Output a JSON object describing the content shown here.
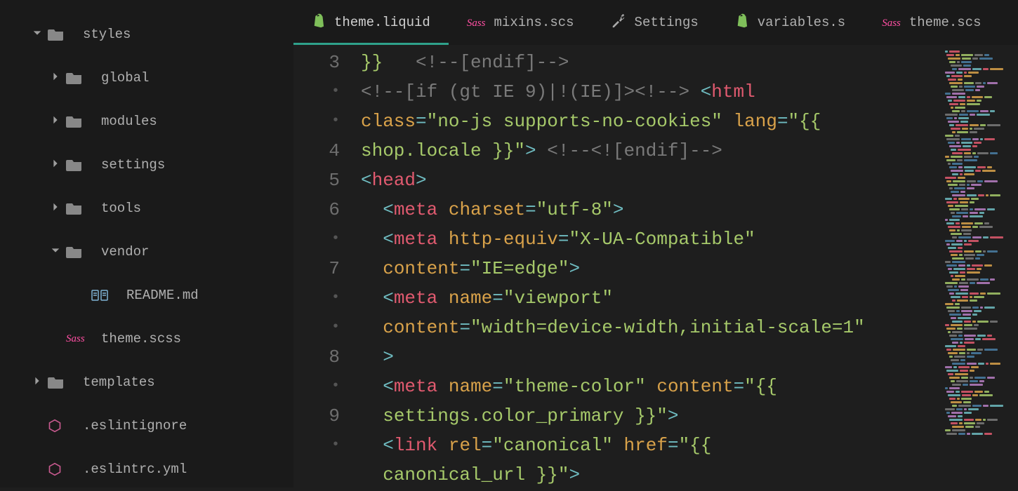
{
  "sidebar": {
    "items": [
      {
        "chevron": "down",
        "icon": "folder",
        "label": "styles",
        "indent": 0
      },
      {
        "chevron": "right",
        "icon": "folder",
        "label": "global",
        "indent": 1
      },
      {
        "chevron": "right",
        "icon": "folder",
        "label": "modules",
        "indent": 1
      },
      {
        "chevron": "right",
        "icon": "folder",
        "label": "settings",
        "indent": 1
      },
      {
        "chevron": "right",
        "icon": "folder",
        "label": "tools",
        "indent": 1
      },
      {
        "chevron": "down",
        "icon": "folder",
        "label": "vendor",
        "indent": 1
      },
      {
        "chevron": "",
        "icon": "markdown",
        "label": "README.md",
        "indent": 2
      },
      {
        "chevron": "",
        "icon": "sass",
        "label": "theme.scss",
        "indent": 1
      },
      {
        "chevron": "right",
        "icon": "folder",
        "label": "templates",
        "indent": 0
      },
      {
        "chevron": "",
        "icon": "hex",
        "label": ".eslintignore",
        "indent": 0
      },
      {
        "chevron": "",
        "icon": "hex",
        "label": ".eslintrc.yml",
        "indent": 0
      }
    ]
  },
  "tabs": [
    {
      "icon": "shopify",
      "label": "theme.liquid",
      "active": true
    },
    {
      "icon": "sass",
      "label": "mixins.scs"
    },
    {
      "icon": "tools",
      "label": "Settings"
    },
    {
      "icon": "shopify",
      "label": "variables.s"
    },
    {
      "icon": "sass",
      "label": "theme.scs"
    }
  ],
  "gutter": [
    "",
    "3",
    "·",
    "·",
    "4",
    "5",
    "6",
    "·",
    "7",
    "·",
    "·",
    "8",
    "·",
    "9",
    "·"
  ],
  "code": {
    "l0": "}}",
    "l0b": "<!--[endif]-->",
    "l1a": "<!--[if (gt IE 9)|!(IE)]><!-->",
    "l1b": "<",
    "l1c": "html",
    "l2a": "class",
    "l2b": "=",
    "l2c": "\"no-js supports-no-cookies\"",
    "l2d": "lang",
    "l2e": "=",
    "l2f": "\"{{",
    "l3a": "shop.locale }}\"",
    "l3b": ">",
    "l3c": "<!--<![endif]-->",
    "l4a": "<",
    "l4b": "head",
    "l4c": ">",
    "l5pad": "  ",
    "l5a": "<",
    "l5b": "meta",
    "l5c": "charset",
    "l5d": "=",
    "l5e": "\"utf-8\"",
    "l5f": ">",
    "l6a": "<",
    "l6b": "meta",
    "l6c": "http-equiv",
    "l6d": "=",
    "l6e": "\"X-UA-Compatible\"",
    "l7a": "content",
    "l7b": "=",
    "l7c": "\"IE=edge\"",
    "l7d": ">",
    "l8a": "<",
    "l8b": "meta",
    "l8c": "name",
    "l8d": "=",
    "l8e": "\"viewport\"",
    "l9a": "content",
    "l9b": "=",
    "l9c": "\"width=device-width,initial-scale=1\"",
    "l10a": ">",
    "l11a": "<",
    "l11b": "meta",
    "l11c": "name",
    "l11d": "=",
    "l11e": "\"theme-color\"",
    "l11f": "content",
    "l11g": "=",
    "l11h": "\"{{",
    "l12a": "settings.color_primary }}\"",
    "l12b": ">",
    "l13a": "<",
    "l13b": "link",
    "l13c": "rel",
    "l13d": "=",
    "l13e": "\"canonical\"",
    "l13f": "href",
    "l13g": "=",
    "l13h": "\"{{",
    "l14a": "canonical_url }}\"",
    "l14b": ">"
  },
  "colors": {
    "punct": "#6fbcc1",
    "tag": "#e05a6f",
    "attr": "#d9a24a",
    "str": "#a6c96a",
    "cmt": "#7a7a7a"
  }
}
